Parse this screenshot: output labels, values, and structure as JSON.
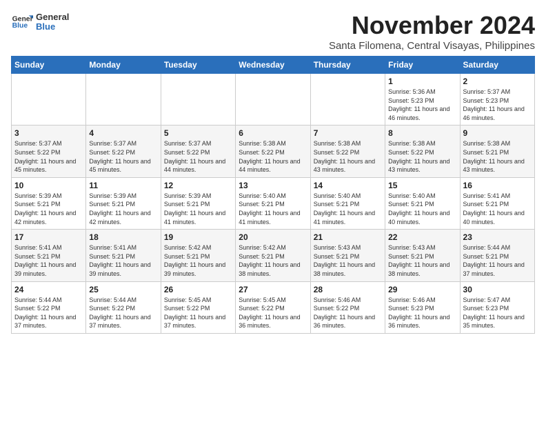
{
  "header": {
    "logo_general": "General",
    "logo_blue": "Blue",
    "month_title": "November 2024",
    "location": "Santa Filomena, Central Visayas, Philippines"
  },
  "weekdays": [
    "Sunday",
    "Monday",
    "Tuesday",
    "Wednesday",
    "Thursday",
    "Friday",
    "Saturday"
  ],
  "weeks": [
    [
      {
        "day": "",
        "info": ""
      },
      {
        "day": "",
        "info": ""
      },
      {
        "day": "",
        "info": ""
      },
      {
        "day": "",
        "info": ""
      },
      {
        "day": "",
        "info": ""
      },
      {
        "day": "1",
        "info": "Sunrise: 5:36 AM\nSunset: 5:23 PM\nDaylight: 11 hours and 46 minutes."
      },
      {
        "day": "2",
        "info": "Sunrise: 5:37 AM\nSunset: 5:23 PM\nDaylight: 11 hours and 46 minutes."
      }
    ],
    [
      {
        "day": "3",
        "info": "Sunrise: 5:37 AM\nSunset: 5:22 PM\nDaylight: 11 hours and 45 minutes."
      },
      {
        "day": "4",
        "info": "Sunrise: 5:37 AM\nSunset: 5:22 PM\nDaylight: 11 hours and 45 minutes."
      },
      {
        "day": "5",
        "info": "Sunrise: 5:37 AM\nSunset: 5:22 PM\nDaylight: 11 hours and 44 minutes."
      },
      {
        "day": "6",
        "info": "Sunrise: 5:38 AM\nSunset: 5:22 PM\nDaylight: 11 hours and 44 minutes."
      },
      {
        "day": "7",
        "info": "Sunrise: 5:38 AM\nSunset: 5:22 PM\nDaylight: 11 hours and 43 minutes."
      },
      {
        "day": "8",
        "info": "Sunrise: 5:38 AM\nSunset: 5:22 PM\nDaylight: 11 hours and 43 minutes."
      },
      {
        "day": "9",
        "info": "Sunrise: 5:38 AM\nSunset: 5:21 PM\nDaylight: 11 hours and 43 minutes."
      }
    ],
    [
      {
        "day": "10",
        "info": "Sunrise: 5:39 AM\nSunset: 5:21 PM\nDaylight: 11 hours and 42 minutes."
      },
      {
        "day": "11",
        "info": "Sunrise: 5:39 AM\nSunset: 5:21 PM\nDaylight: 11 hours and 42 minutes."
      },
      {
        "day": "12",
        "info": "Sunrise: 5:39 AM\nSunset: 5:21 PM\nDaylight: 11 hours and 41 minutes."
      },
      {
        "day": "13",
        "info": "Sunrise: 5:40 AM\nSunset: 5:21 PM\nDaylight: 11 hours and 41 minutes."
      },
      {
        "day": "14",
        "info": "Sunrise: 5:40 AM\nSunset: 5:21 PM\nDaylight: 11 hours and 41 minutes."
      },
      {
        "day": "15",
        "info": "Sunrise: 5:40 AM\nSunset: 5:21 PM\nDaylight: 11 hours and 40 minutes."
      },
      {
        "day": "16",
        "info": "Sunrise: 5:41 AM\nSunset: 5:21 PM\nDaylight: 11 hours and 40 minutes."
      }
    ],
    [
      {
        "day": "17",
        "info": "Sunrise: 5:41 AM\nSunset: 5:21 PM\nDaylight: 11 hours and 39 minutes."
      },
      {
        "day": "18",
        "info": "Sunrise: 5:41 AM\nSunset: 5:21 PM\nDaylight: 11 hours and 39 minutes."
      },
      {
        "day": "19",
        "info": "Sunrise: 5:42 AM\nSunset: 5:21 PM\nDaylight: 11 hours and 39 minutes."
      },
      {
        "day": "20",
        "info": "Sunrise: 5:42 AM\nSunset: 5:21 PM\nDaylight: 11 hours and 38 minutes."
      },
      {
        "day": "21",
        "info": "Sunrise: 5:43 AM\nSunset: 5:21 PM\nDaylight: 11 hours and 38 minutes."
      },
      {
        "day": "22",
        "info": "Sunrise: 5:43 AM\nSunset: 5:21 PM\nDaylight: 11 hours and 38 minutes."
      },
      {
        "day": "23",
        "info": "Sunrise: 5:44 AM\nSunset: 5:21 PM\nDaylight: 11 hours and 37 minutes."
      }
    ],
    [
      {
        "day": "24",
        "info": "Sunrise: 5:44 AM\nSunset: 5:22 PM\nDaylight: 11 hours and 37 minutes."
      },
      {
        "day": "25",
        "info": "Sunrise: 5:44 AM\nSunset: 5:22 PM\nDaylight: 11 hours and 37 minutes."
      },
      {
        "day": "26",
        "info": "Sunrise: 5:45 AM\nSunset: 5:22 PM\nDaylight: 11 hours and 37 minutes."
      },
      {
        "day": "27",
        "info": "Sunrise: 5:45 AM\nSunset: 5:22 PM\nDaylight: 11 hours and 36 minutes."
      },
      {
        "day": "28",
        "info": "Sunrise: 5:46 AM\nSunset: 5:22 PM\nDaylight: 11 hours and 36 minutes."
      },
      {
        "day": "29",
        "info": "Sunrise: 5:46 AM\nSunset: 5:23 PM\nDaylight: 11 hours and 36 minutes."
      },
      {
        "day": "30",
        "info": "Sunrise: 5:47 AM\nSunset: 5:23 PM\nDaylight: 11 hours and 35 minutes."
      }
    ]
  ]
}
